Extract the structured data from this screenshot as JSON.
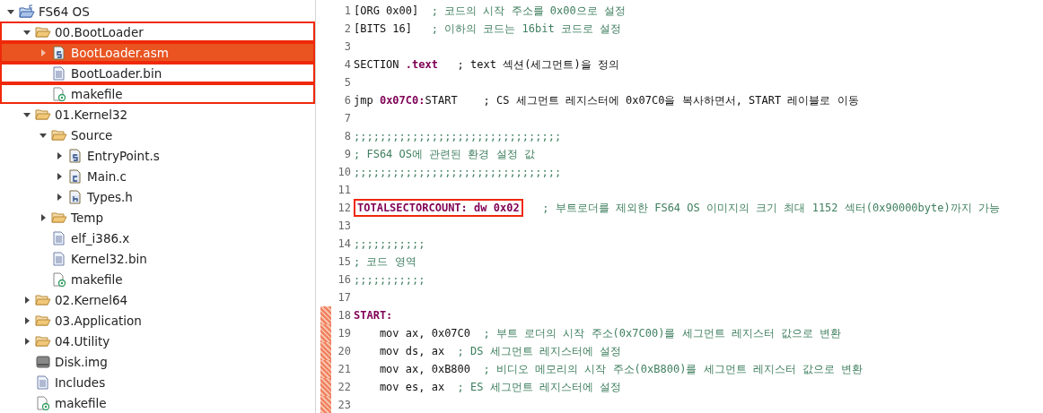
{
  "project_tree": {
    "items": [
      {
        "label": "FS64 OS",
        "kind": "project",
        "expanded": true,
        "selected": false,
        "marked": false,
        "children": [
          {
            "label": "00.BootLoader",
            "kind": "folder",
            "expanded": true,
            "selected": false,
            "marked": true,
            "children": [
              {
                "label": "BootLoader.asm",
                "kind": "asm",
                "expanded": false,
                "selected": true,
                "marked": true
              },
              {
                "label": "BootLoader.bin",
                "kind": "file",
                "selected": false,
                "marked": true
              },
              {
                "label": "makefile",
                "kind": "makefile",
                "selected": false,
                "marked": true
              }
            ]
          },
          {
            "label": "01.Kernel32",
            "kind": "folder",
            "expanded": true,
            "selected": false,
            "marked": false,
            "children": [
              {
                "label": "Source",
                "kind": "folder",
                "expanded": true,
                "selected": false,
                "marked": false,
                "children": [
                  {
                    "label": "EntryPoint.s",
                    "kind": "asm",
                    "expanded": false,
                    "selected": false,
                    "marked": false
                  },
                  {
                    "label": "Main.c",
                    "kind": "c",
                    "expanded": false,
                    "selected": false,
                    "marked": false
                  },
                  {
                    "label": "Types.h",
                    "kind": "h",
                    "expanded": false,
                    "selected": false,
                    "marked": false
                  }
                ]
              },
              {
                "label": "Temp",
                "kind": "folder",
                "expanded": false,
                "selected": false,
                "marked": false
              },
              {
                "label": "elf_i386.x",
                "kind": "file",
                "selected": false,
                "marked": false
              },
              {
                "label": "Kernel32.bin",
                "kind": "file",
                "selected": false,
                "marked": false
              },
              {
                "label": "makefile",
                "kind": "makefile",
                "selected": false,
                "marked": false
              }
            ]
          },
          {
            "label": "02.Kernel64",
            "kind": "folder",
            "expanded": false,
            "selected": false,
            "marked": false
          },
          {
            "label": "03.Application",
            "kind": "folder",
            "expanded": false,
            "selected": false,
            "marked": false
          },
          {
            "label": "04.Utility",
            "kind": "folder",
            "expanded": false,
            "selected": false,
            "marked": false
          },
          {
            "label": "Disk.img",
            "kind": "disk",
            "selected": false,
            "marked": false
          },
          {
            "label": "Includes",
            "kind": "file",
            "selected": false,
            "marked": false
          },
          {
            "label": "makefile",
            "kind": "makefile",
            "selected": false,
            "marked": false
          }
        ]
      }
    ]
  },
  "editor": {
    "lines": [
      {
        "number": "1",
        "changed": false,
        "segments": [
          {
            "kind": "plain",
            "text": "[ORG 0x00]"
          },
          {
            "kind": "comment",
            "text": "  ; 코드의 시작 주소를 0x00으로 설정"
          }
        ]
      },
      {
        "number": "2",
        "changed": false,
        "segments": [
          {
            "kind": "plain",
            "text": "[BITS 16]"
          },
          {
            "kind": "comment",
            "text": "   ; 이하의 코드는 16bit 코드로 설정"
          }
        ]
      },
      {
        "number": "3",
        "changed": false
      },
      {
        "number": "4",
        "changed": false,
        "segments": [
          {
            "kind": "plain",
            "text": "SECTION "
          },
          {
            "kind": "keyword",
            "text": ".text"
          },
          {
            "kind": "plain",
            "text": "   ; text 섹션(세그먼트)을 정의"
          }
        ]
      },
      {
        "number": "5",
        "changed": false
      },
      {
        "number": "6",
        "changed": false,
        "segments": [
          {
            "kind": "plain",
            "text": "jmp "
          },
          {
            "kind": "keyword",
            "text": "0x07C0:"
          },
          {
            "kind": "plain",
            "text": "START    ; CS 세그먼트 레지스터에 0x07C0을 복사하면서, START 레이블로 이동"
          }
        ]
      },
      {
        "number": "7",
        "changed": false
      },
      {
        "number": "8",
        "changed": false,
        "segments": [
          {
            "kind": "comment",
            "text": ";;;;;;;;;;;;;;;;;;;;;;;;;;;;;;;;"
          }
        ]
      },
      {
        "number": "9",
        "changed": false,
        "segments": [
          {
            "kind": "comment",
            "text": "; FS64 OS에 관련된 환경 설정 값"
          }
        ]
      },
      {
        "number": "10",
        "changed": false,
        "segments": [
          {
            "kind": "comment",
            "text": ";;;;;;;;;;;;;;;;;;;;;;;;;;;;;;;;"
          }
        ]
      },
      {
        "number": "11",
        "changed": false
      },
      {
        "number": "12",
        "changed": false,
        "segments": [
          {
            "kind": "boxed",
            "text": "TOTALSECTORCOUNT: dw 0x02"
          },
          {
            "kind": "comment",
            "text": "   ; 부트로더를 제외한 FS64 OS 이미지의 크기 최대 1152 섹터(0x90000byte)까지 가능"
          }
        ]
      },
      {
        "number": "13",
        "changed": false
      },
      {
        "number": "14",
        "changed": false,
        "segments": [
          {
            "kind": "comment",
            "text": ";;;;;;;;;;;"
          }
        ]
      },
      {
        "number": "15",
        "changed": false,
        "segments": [
          {
            "kind": "comment",
            "text": "; 코드 영역"
          }
        ]
      },
      {
        "number": "16",
        "changed": false,
        "segments": [
          {
            "kind": "comment",
            "text": ";;;;;;;;;;;"
          }
        ]
      },
      {
        "number": "17",
        "changed": false
      },
      {
        "number": "18",
        "changed": true,
        "segments": [
          {
            "kind": "keyword",
            "text": "START:"
          }
        ]
      },
      {
        "number": "19",
        "changed": true,
        "segments": [
          {
            "kind": "plain",
            "text": "    mov ax, 0x07C0"
          },
          {
            "kind": "comment",
            "text": "  ; 부트 로더의 시작 주소(0x7C00)를 세그먼트 레지스터 값으로 변환"
          }
        ]
      },
      {
        "number": "20",
        "changed": true,
        "segments": [
          {
            "kind": "plain",
            "text": "    mov ds, ax"
          },
          {
            "kind": "comment",
            "text": "  ; DS 세그먼트 레지스터에 설정"
          }
        ]
      },
      {
        "number": "21",
        "changed": true,
        "segments": [
          {
            "kind": "plain",
            "text": "    mov ax, 0xB800"
          },
          {
            "kind": "comment",
            "text": "  ; 비디오 메모리의 시작 주소(0xB800)를 세그먼트 레지스터 값으로 변환"
          }
        ]
      },
      {
        "number": "22",
        "changed": true,
        "segments": [
          {
            "kind": "plain",
            "text": "    mov es, ax"
          },
          {
            "kind": "comment",
            "text": "  ; ES 세그먼트 레지스터에 설정"
          }
        ]
      },
      {
        "number": "23",
        "changed": true
      }
    ]
  }
}
